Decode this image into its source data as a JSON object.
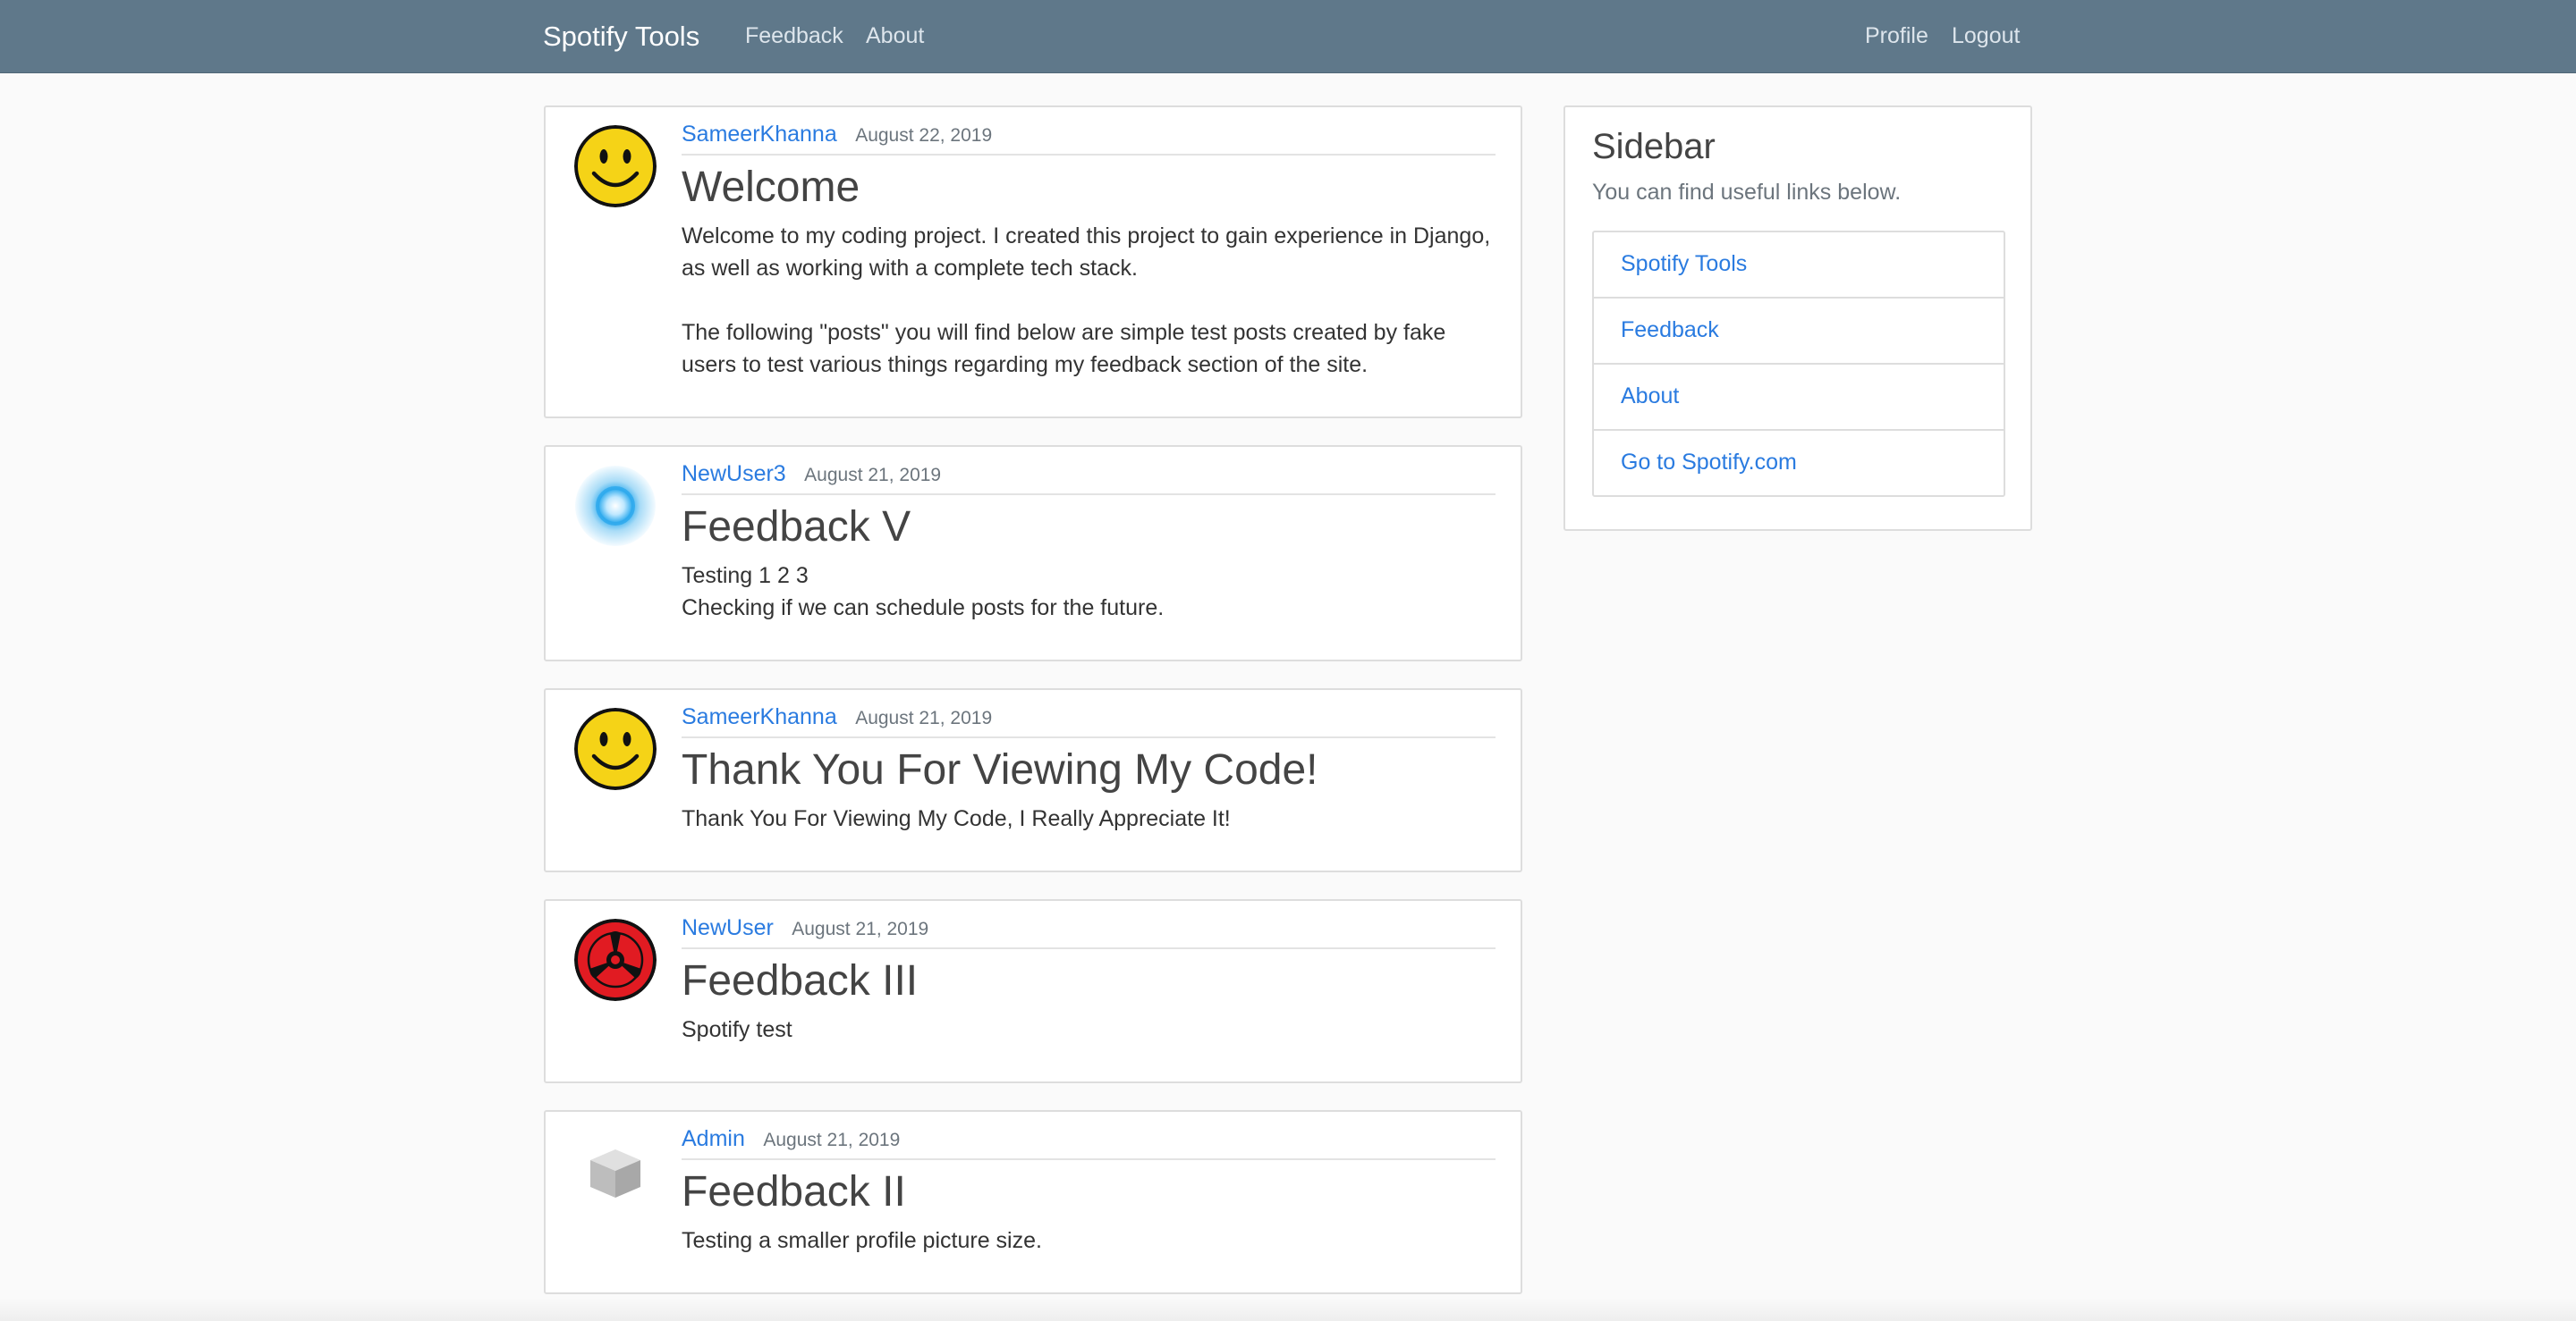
{
  "navbar": {
    "brand": "Spotify Tools",
    "links": [
      "Feedback",
      "About"
    ],
    "right_links": [
      "Profile",
      "Logout"
    ],
    "bg_color": "#5f788a"
  },
  "posts": [
    {
      "author": "SameerKhanna",
      "date": "August 22, 2019",
      "title": "Welcome",
      "body": "Welcome to my coding project. I created this project to gain experience in Django, as well as working with a complete tech stack.\n\nThe following \"posts\" you will find below are simple test posts created by fake users to test various things regarding my feedback section of the site.",
      "avatar_icon": "smiley-face-icon"
    },
    {
      "author": "NewUser3",
      "date": "August 21, 2019",
      "title": "Feedback V",
      "body": "Testing 1 2 3\nChecking if we can schedule posts for the future.",
      "avatar_icon": "glowing-orb-icon"
    },
    {
      "author": "SameerKhanna",
      "date": "August 21, 2019",
      "title": "Thank You For Viewing My Code!",
      "body": "Thank You For Viewing My Code, I Really Appreciate It!",
      "avatar_icon": "smiley-face-icon"
    },
    {
      "author": "NewUser",
      "date": "August 21, 2019",
      "title": "Feedback III",
      "body": "Spotify test",
      "avatar_icon": "red-sharingan-icon"
    },
    {
      "author": "Admin",
      "date": "August 21, 2019",
      "title": "Feedback II",
      "body": "Testing a smaller profile picture size.",
      "avatar_icon": "gray-cube-icon"
    }
  ],
  "sidebar": {
    "title": "Sidebar",
    "subtitle": "You can find useful links below.",
    "links": [
      "Spotify Tools",
      "Feedback",
      "About",
      "Go to Spotify.com"
    ]
  },
  "colors": {
    "link": "#2a7be0",
    "text": "#444444",
    "muted": "#6c757d",
    "page_bg": "#fafafa"
  }
}
